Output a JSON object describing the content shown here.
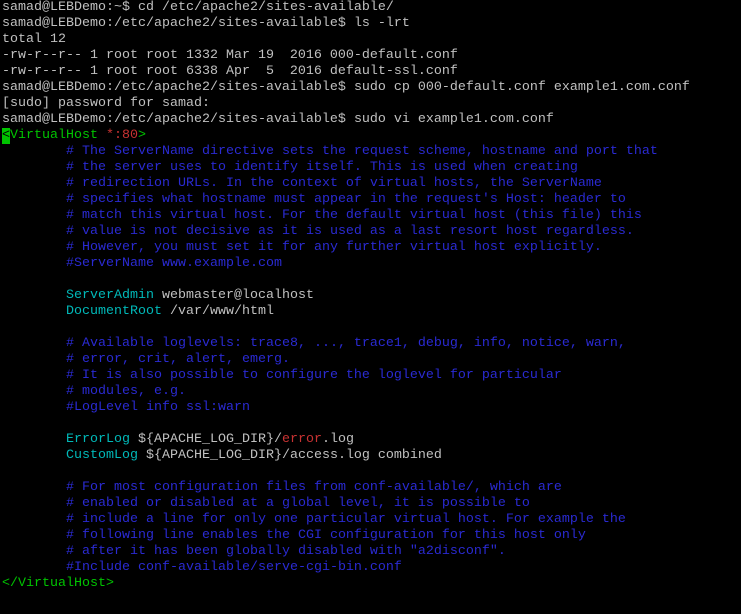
{
  "colors": {
    "background": "#000000",
    "text": "#c0c0c0",
    "comment": "#2a2ad2",
    "tag": "#00c400",
    "keyword": "#00b8b8",
    "special": "#c83232",
    "cursor": "#00c400"
  },
  "shell": {
    "lines": [
      {
        "prompt": "samad@LEBDemo:~$",
        "command": "cd /etc/apache2/sites-available/"
      },
      {
        "prompt": "samad@LEBDemo:/etc/apache2/sites-available$",
        "command": "ls -lrt"
      },
      {
        "output": "total 12"
      },
      {
        "output": "-rw-r--r-- 1 root root 1332 Mar 19  2016 000-default.conf"
      },
      {
        "output": "-rw-r--r-- 1 root root 6338 Apr  5  2016 default-ssl.conf"
      },
      {
        "prompt": "samad@LEBDemo:/etc/apache2/sites-available$",
        "command": "sudo cp 000-default.conf example1.com.conf"
      },
      {
        "output": "[sudo] password for samad:"
      },
      {
        "prompt": "samad@LEBDemo:/etc/apache2/sites-available$",
        "command": "sudo vi example1.com.conf"
      }
    ]
  },
  "vim": {
    "open_tag": {
      "lt": "<",
      "name": "VirtualHost",
      "addr": "*:80",
      "gt": ">"
    },
    "comments_servername": [
      "# The ServerName directive sets the request scheme, hostname and port that",
      "# the server uses to identify itself. This is used when creating",
      "# redirection URLs. In the context of virtual hosts, the ServerName",
      "# specifies what hostname must appear in the request's Host: header to",
      "# match this virtual host. For the default virtual host (this file) this",
      "# value is not decisive as it is used as a last resort host regardless.",
      "# However, you must set it for any further virtual host explicitly."
    ],
    "servername": "#ServerName www.example.com",
    "server_admin": {
      "directive": "ServerAdmin",
      "value": "webmaster@localhost"
    },
    "document_root": {
      "directive": "DocumentRoot",
      "value": "/var/www/html"
    },
    "comments_loglevel": [
      "# Available loglevels: trace8, ..., trace1, debug, info, notice, warn,",
      "# error, crit, alert, emerg.",
      "# It is also possible to configure the loglevel for particular",
      "# modules, e.g."
    ],
    "loglevel": "#LogLevel info ssl:warn",
    "error_log": {
      "directive": "ErrorLog",
      "value_pre": "${APACHE_LOG_DIR}/",
      "value_keyword": "error",
      "value_post": ".log"
    },
    "custom_log": {
      "directive": "CustomLog",
      "value": "${APACHE_LOG_DIR}/access.log combined"
    },
    "comments_include": [
      "# For most configuration files from conf-available/, which are",
      "# enabled or disabled at a global level, it is possible to",
      "# include a line for only one particular virtual host. For example the",
      "# following line enables the CGI configuration for this host only",
      "# after it has been globally disabled with \"a2disconf\"."
    ],
    "include": "#Include conf-available/serve-cgi-bin.conf",
    "close_tag": "</VirtualHost>"
  }
}
